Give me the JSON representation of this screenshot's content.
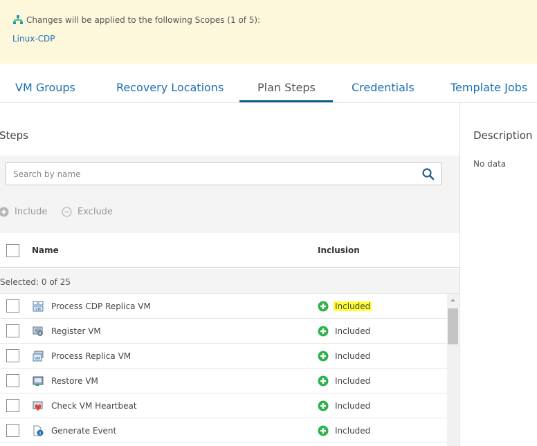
{
  "banner": {
    "message": "Changes will be applied to the following Scopes (1 of 5):",
    "scope_link": "Linux-CDP",
    "icon": "scope-hierarchy-icon"
  },
  "tabs": [
    {
      "label": "VM Groups",
      "active": false
    },
    {
      "label": "Recovery Locations",
      "active": false
    },
    {
      "label": "Plan Steps",
      "active": true
    },
    {
      "label": "Credentials",
      "active": false
    },
    {
      "label": "Template Jobs",
      "active": false
    }
  ],
  "steps": {
    "title": "Steps",
    "search_placeholder": "Search by name",
    "include_label": "Include",
    "exclude_label": "Exclude",
    "columns": {
      "name": "Name",
      "inclusion": "Inclusion"
    },
    "selected_text": "Selected:  0 of 25",
    "rows": [
      {
        "name": "Process CDP Replica VM",
        "inclusion": "Included",
        "icon": "cdp-replica-icon",
        "highlighted": true
      },
      {
        "name": "Register VM",
        "inclusion": "Included",
        "icon": "register-vm-icon",
        "highlighted": false
      },
      {
        "name": "Process Replica VM",
        "inclusion": "Included",
        "icon": "replica-vm-icon",
        "highlighted": false
      },
      {
        "name": "Restore VM",
        "inclusion": "Included",
        "icon": "restore-vm-icon",
        "highlighted": false
      },
      {
        "name": "Check VM Heartbeat",
        "inclusion": "Included",
        "icon": "heartbeat-icon",
        "highlighted": false
      },
      {
        "name": "Generate Event",
        "inclusion": "Included",
        "icon": "generate-event-icon",
        "highlighted": false
      }
    ]
  },
  "description": {
    "title": "Description",
    "text": "No data"
  },
  "colors": {
    "banner_bg": "#fdf8dc",
    "link": "#1a6fb5",
    "active_tab_underline": "#0f5e86",
    "included_green": "#2db34a",
    "highlight": "#ffff33"
  }
}
